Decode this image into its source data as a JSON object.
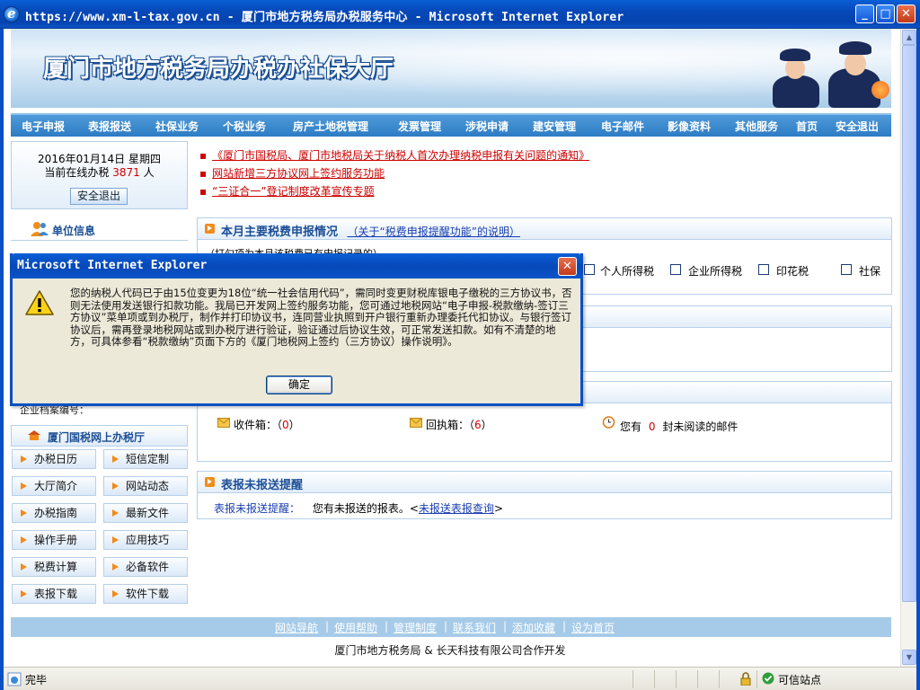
{
  "window": {
    "title": "https://www.xm-l-tax.gov.cn - 厦门市地方税务局办税服务中心 - Microsoft Internet Explorer",
    "minimize": "_",
    "maximize": "□",
    "close": "✕"
  },
  "banner": {
    "title": "厦门市地方税务局办税办社保大厅"
  },
  "menu": [
    "电子申报",
    "表报报送",
    "社保业务",
    "个税业务",
    "房产土地税管理",
    "发票管理",
    "涉税申请",
    "建安管理",
    "电子邮件",
    "影像资料",
    "其他服务",
    "首页",
    "安全退出"
  ],
  "datebox": {
    "date": "2016年01月14日 星期四",
    "online_prefix": "当前在线办税",
    "online_count": "3871",
    "online_suffix": "人",
    "logout": "安全退出"
  },
  "unit_info": "单位信息",
  "tax_file_label": "企业档案编号：",
  "national_hall": "厦门国税网上办税厅",
  "side_buttons": [
    [
      "办税日历",
      "短信定制"
    ],
    [
      "大厅简介",
      "网站动态"
    ],
    [
      "办税指南",
      "最新文件"
    ],
    [
      "操作手册",
      "应用技巧"
    ],
    [
      "税费计算",
      "必备软件"
    ],
    [
      "表报下载",
      "软件下载"
    ]
  ],
  "notices": [
    "《厦门市国税局、厦门市地税局关于纳税人首次办理纳税申报有关问题的通知》",
    "网站新增三方协议网上签约服务功能",
    "“三证合一”登记制度改革宣传专题"
  ],
  "monthly": {
    "title": "本月主要税费申报情况",
    "link": "（关于“税费申报提醒功能”的说明）",
    "hint": "（打勾项为本月该税费已有申报记录的）",
    "checks": [
      "个人所得税",
      "企业所得税",
      "印花税",
      "社保"
    ]
  },
  "mail": {
    "inbox_label": "收件箱：（",
    "inbox_count": "0",
    "inbox_end": "）",
    "receipt_label": "回执箱：（",
    "receipt_count": "6",
    "receipt_end": "）",
    "unread_prefix": "您有",
    "unread_count": "0",
    "unread_suffix": "封未阅读的邮件"
  },
  "unreported": {
    "title": "表报未报送提醒",
    "label": "表报未报送提醒：",
    "text": "您有未报送的报表。",
    "link": "未报送表报查询"
  },
  "footer": {
    "links": [
      "网站导航",
      "使用帮助",
      "管理制度",
      "联系我们",
      "添加收藏",
      "设为首页"
    ],
    "copyright": "厦门市地方税务局 & 长天科技有限公司合作开发"
  },
  "status": {
    "done": "完毕",
    "zone": "可信站点"
  },
  "dialog": {
    "title": "Microsoft Internet Explorer",
    "message": "您的纳税人代码已于由15位变更为18位“统一社会信用代码”，需同时变更财税库银电子缴税的三方协议书，否则无法使用发送银行扣款功能。我局已开发网上签约服务功能，您可通过地税网站“电子申报-税款缴纳-签订三方协议”菜单项或到办税厅，制作并打印协议书，连同营业执照到开户银行重新办理委托代扣协议。与银行签订协议后，需再登录地税网站或到办税厅进行验证，验证通过后协议生效，可正常发送扣款。如有不清楚的地方，可具体参看“税款缴纳”页面下方的《厦门地税网上签约（三方协议）操作说明》。",
    "ok": "确定"
  },
  "colors": {
    "xp_blue": "#0a4fc4",
    "menu_blue": "#2d7cc4",
    "link_red": "#cc0000",
    "accent_orange": "#f08c1a"
  }
}
